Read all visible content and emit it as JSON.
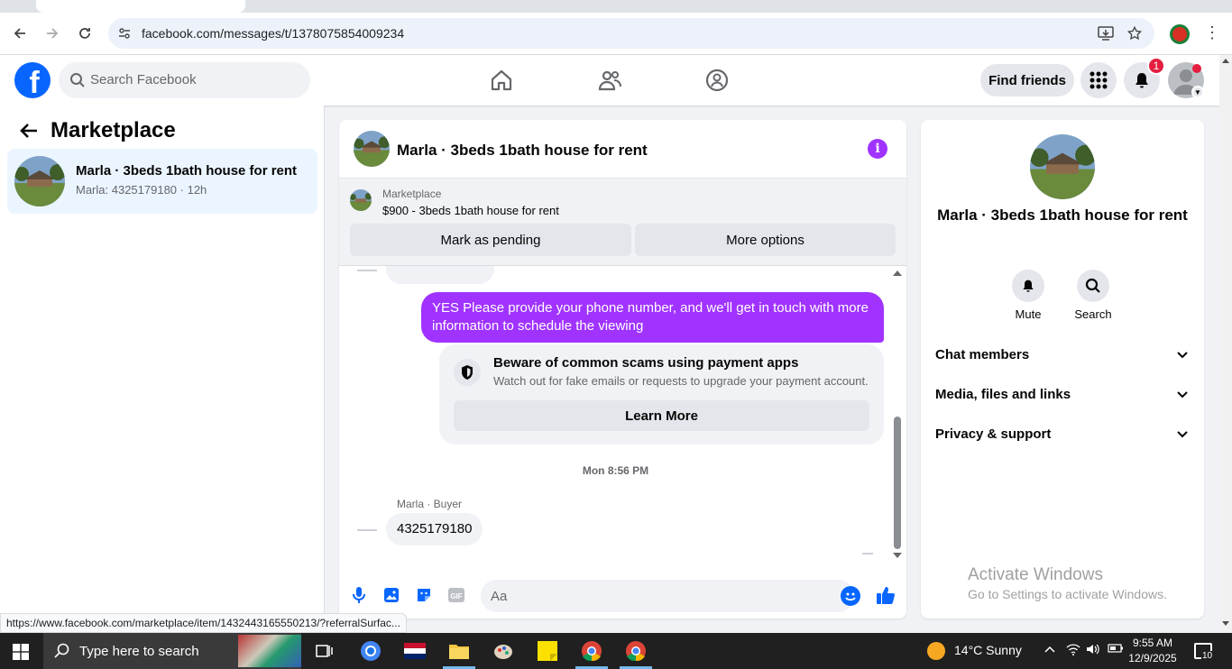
{
  "browser": {
    "url": "facebook.com/messages/t/1378075854009234",
    "status_url": "https://www.facebook.com/marketplace/item/1432443165550213/?referralSurfac..."
  },
  "fb": {
    "search_placeholder": "Search Facebook",
    "find_friends": "Find friends",
    "notifications_count": "1"
  },
  "left": {
    "title": "Marketplace",
    "conversation": {
      "name": "Marla · 3beds 1bath house for rent",
      "preview": "Marla: 4325179180 · 12h"
    }
  },
  "chat": {
    "title": "Marla · 3beds 1bath house for rent",
    "listing_label": "Marketplace",
    "listing_desc": "$900 - 3beds 1bath house for rent",
    "mark_pending": "Mark as pending",
    "more_options": "More options",
    "outgoing_message": "YES Please provide your phone number, and we'll get in touch with more information to schedule the viewing",
    "scam_title": "Beware of common scams using payment apps",
    "scam_body": "Watch out for fake emails or requests to upgrade your payment account.",
    "learn_more": "Learn More",
    "timestamp": "Mon 8:56 PM",
    "sender": "Marla · Buyer",
    "incoming_message": "4325179180",
    "composer_placeholder": "Aa"
  },
  "right": {
    "name": "Marla · 3beds 1bath house for rent",
    "mute": "Mute",
    "search": "Search",
    "sections": [
      "Chat members",
      "Media, files and links",
      "Privacy & support"
    ],
    "activate_title": "Activate Windows",
    "activate_sub": "Go to Settings to activate Windows."
  },
  "taskbar": {
    "search_placeholder": "Type here to search",
    "weather": "14°C  Sunny",
    "time": "9:55 AM",
    "date": "12/9/2025",
    "notification_count": "10"
  },
  "colors": {
    "fb_blue": "#0866ff",
    "outgoing_bubble": "#a033ff",
    "selected_conversation": "#ebf5ff"
  }
}
